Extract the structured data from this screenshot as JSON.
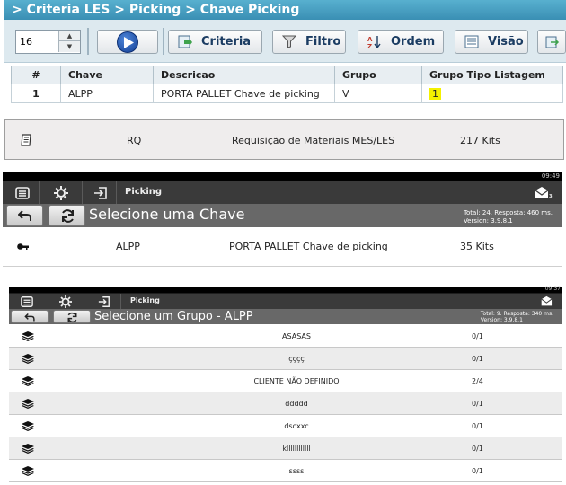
{
  "panel1": {
    "breadcrumb": "> Criteria LES > Picking > Chave Picking",
    "spinner_value": "16",
    "buttons": {
      "criteria": "Criteria",
      "filtro": "Filtro",
      "ordem": "Ordem",
      "visao": "Visão"
    },
    "columns": [
      "#",
      "Chave",
      "Descricao",
      "Grupo",
      "Grupo Tipo Listagem"
    ],
    "rows": [
      {
        "num": "1",
        "chave": "ALPP",
        "descricao": "PORTA PALLET Chave de picking",
        "grupo": "V",
        "grupo_tipo": "1"
      }
    ]
  },
  "panel2": {
    "code": "RQ",
    "description": "Requisição de Materiais MES/LES",
    "count": "217 Kits"
  },
  "panel3": {
    "app_name": "Picking",
    "title": "Selecione uma Chave",
    "meta_line1": "Total: 24. Resposta: 460 ms.",
    "meta_line2": "Version: 3.9.8.1",
    "status_time": "09:49",
    "row": {
      "code": "ALPP",
      "description": "PORTA PALLET Chave de picking",
      "count": "35 Kits"
    }
  },
  "panel4": {
    "app_name": "Picking",
    "title": "Selecione um Grupo - ALPP",
    "meta_line1": "Total: 9. Resposta: 340 ms.",
    "meta_line2": "Version: 3.9.8.1",
    "status_time": "09:37",
    "rows": [
      {
        "name": "ASASAS",
        "count": "0/1"
      },
      {
        "name": "çççç",
        "count": "0/1"
      },
      {
        "name": "CLIENTE NÃO DEFINIDO",
        "count": "2/4"
      },
      {
        "name": "ddddd",
        "count": "0/1"
      },
      {
        "name": "dscxxc",
        "count": "0/1"
      },
      {
        "name": "kllllllllllll",
        "count": "0/1"
      },
      {
        "name": "ssss",
        "count": "0/1"
      }
    ]
  },
  "icons": {
    "menu": "menu-icon",
    "settings": "gear-icon",
    "logout": "logout-icon",
    "back": "back-arrow-icon",
    "refresh": "refresh-icon",
    "key": "key-icon",
    "layers": "layers-icon",
    "document": "document-icon"
  },
  "colors": {
    "crumb_bg": "#3a8fb4",
    "toolbar_bg": "#dde9ef",
    "highlight": "#f4f100",
    "dark_bar": "#3a3a3a",
    "title_bar": "#686868"
  }
}
